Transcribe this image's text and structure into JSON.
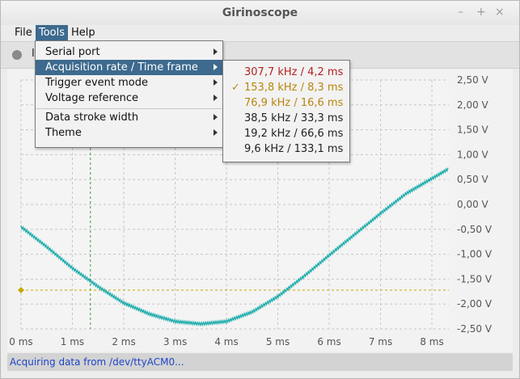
{
  "window": {
    "title": "Girinoscope",
    "controls": [
      "–",
      "+",
      "×"
    ]
  },
  "menubar": [
    {
      "label": "File",
      "active": false
    },
    {
      "label": "Tools",
      "active": true
    },
    {
      "label": "Help",
      "active": false
    }
  ],
  "toolbar": {
    "label": "I"
  },
  "tools_menu": {
    "items": [
      {
        "label": "Serial port",
        "submenu": true,
        "highlighted": false
      },
      {
        "label": "Acquisition rate / Time frame",
        "submenu": true,
        "highlighted": true
      },
      {
        "label": "Trigger event mode",
        "submenu": true,
        "highlighted": false
      },
      {
        "label": "Voltage reference",
        "submenu": true,
        "highlighted": false
      },
      {
        "label": "Data stroke width",
        "submenu": true,
        "highlighted": false
      },
      {
        "label": "Theme",
        "submenu": true,
        "highlighted": false
      }
    ]
  },
  "rate_submenu": {
    "items": [
      {
        "label": "307,7 kHz / 4,2 ms",
        "color": "#b22222",
        "checked": false
      },
      {
        "label": "153,8 kHz / 8,3 ms",
        "color": "#b8860b",
        "checked": true
      },
      {
        "label": "76,9 kHz / 16,6 ms",
        "color": "#b8860b",
        "checked": false
      },
      {
        "label": "38,5 kHz / 33,3 ms",
        "color": "#222222",
        "checked": false
      },
      {
        "label": "19,2 kHz / 66,6 ms",
        "color": "#222222",
        "checked": false
      },
      {
        "label": "9,6 kHz / 133,1 ms",
        "color": "#222222",
        "checked": false
      }
    ],
    "check_mark": "✓"
  },
  "chart_data": {
    "type": "line",
    "x_ticks": [
      "0 ms",
      "1 ms",
      "2 ms",
      "3 ms",
      "4 ms",
      "5 ms",
      "6 ms",
      "7 ms",
      "8 ms"
    ],
    "y_ticks": [
      "2,50 V",
      "2,00 V",
      "1,50 V",
      "1,00 V",
      "0,50 V",
      "0,00 V",
      "-0,50 V",
      "-1,00 V",
      "-1,50 V",
      "-2,00 V",
      "-2,50 V"
    ],
    "xlim": [
      0,
      8.33
    ],
    "ylim": [
      -2.5,
      2.5
    ],
    "grid": true,
    "series": [
      {
        "color": "#1aabab",
        "x": [
          0,
          0.5,
          1.0,
          1.5,
          2.0,
          2.5,
          3.0,
          3.5,
          4.0,
          4.5,
          5.0,
          5.5,
          6.0,
          6.5,
          7.0,
          7.5,
          8.0,
          8.33
        ],
        "y": [
          -0.45,
          -0.85,
          -1.28,
          -1.65,
          -1.98,
          -2.2,
          -2.35,
          -2.4,
          -2.35,
          -2.16,
          -1.85,
          -1.45,
          -1.02,
          -0.6,
          -0.18,
          0.22,
          0.52,
          0.72
        ]
      }
    ],
    "trigger": {
      "time_ms": 1.35,
      "voltage": -1.72,
      "color": "#c8a800"
    }
  },
  "status": {
    "text": "Acquiring data from /dev/ttyACM0..."
  }
}
